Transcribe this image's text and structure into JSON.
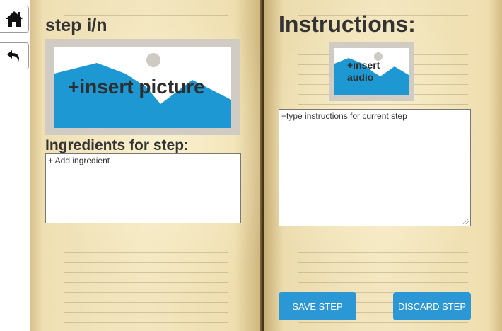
{
  "toolbar": {
    "home_icon": "home-icon",
    "back_icon": "undo-icon"
  },
  "left_page": {
    "step_title": "step i/n",
    "picture_caption": "+insert picture",
    "ingredients_heading": "Ingredients for step:",
    "ingredients_text": "+ Add ingredient"
  },
  "right_page": {
    "instructions_heading": "Instructions:",
    "audio_caption": "+insert audio",
    "instructions_text": "+type instructions for current step"
  },
  "buttons": {
    "save": "SAVE STEP",
    "discard": "DISCARD STEP"
  },
  "colors": {
    "accent": "#2b97d5",
    "placeholder_blue": "#1e98d3",
    "text_dark": "#333333"
  }
}
